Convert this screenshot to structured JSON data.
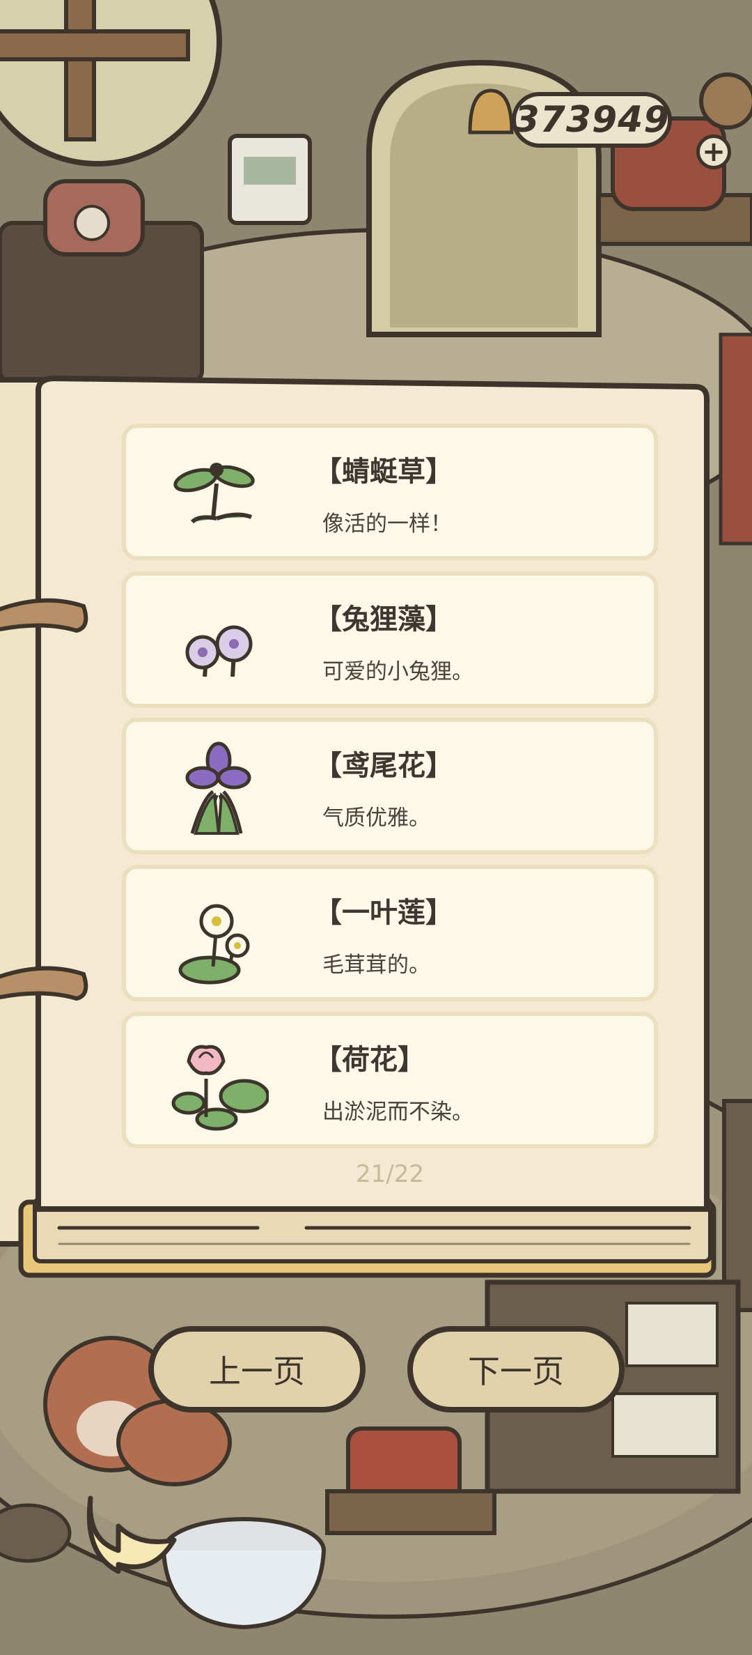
{
  "hud": {
    "currency_amount": "373949",
    "add_icon": "plus-icon"
  },
  "book": {
    "entries": [
      {
        "name": "【蜻蜓草】",
        "desc": "像活的一样！",
        "icon": "dragonfly-grass-icon"
      },
      {
        "name": "【兔狸藻】",
        "desc": "可爱的小兔狸。",
        "icon": "bunny-flower-icon"
      },
      {
        "name": "【鸢尾花】",
        "desc": "气质优雅。",
        "icon": "iris-icon"
      },
      {
        "name": "【一叶莲】",
        "desc": "毛茸茸的。",
        "icon": "one-leaf-lotus-icon"
      },
      {
        "name": "【荷花】",
        "desc": "出淤泥而不染。",
        "icon": "lotus-icon"
      }
    ],
    "page_indicator": "21/22"
  },
  "nav": {
    "prev_label": "上一页",
    "next_label": "下一页"
  },
  "colors": {
    "page_bg": "#f4e9d3",
    "card_bg": "#fdf9e9",
    "button_bg": "#e2d2ac",
    "outline": "#3d352c"
  }
}
